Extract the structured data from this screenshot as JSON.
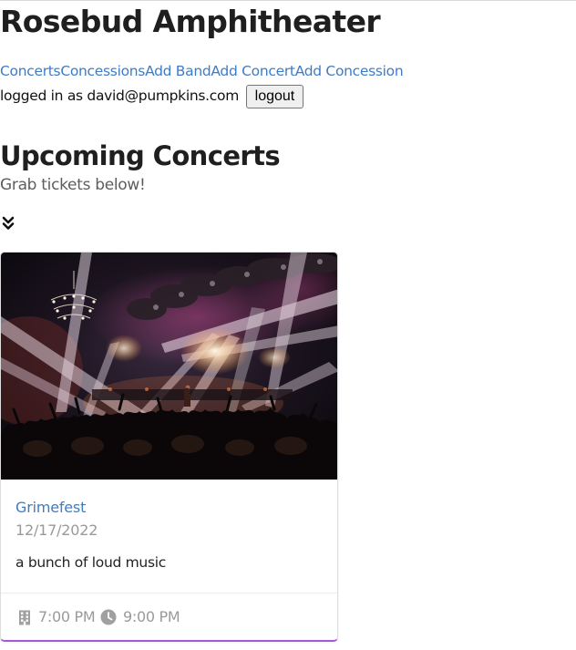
{
  "header": {
    "site_title": "Rosebud Amphitheater"
  },
  "nav": {
    "items": [
      {
        "label": "Concerts"
      },
      {
        "label": "Concessions"
      },
      {
        "label": "Add Band"
      },
      {
        "label": "Add Concert"
      },
      {
        "label": "Add Concession"
      }
    ]
  },
  "session": {
    "logged_in_text": "logged in as david@pumpkins.com",
    "logout_label": "logout"
  },
  "main": {
    "section_title": "Upcoming Concerts",
    "subtitle": "Grab tickets below!",
    "expand_icon": "double-chevron-down-icon"
  },
  "concerts": [
    {
      "band": "Grimefest",
      "date": "12/17/2022",
      "description": "a bunch of loud music",
      "door_time": "7:00 PM",
      "end_time": "9:00 PM",
      "image": "concert-crowd-stage-lights",
      "door_icon": "building-icon",
      "end_icon": "clock-icon"
    }
  ],
  "colors": {
    "link": "#3d7cc9",
    "muted": "#9a9a9a",
    "card_accent": "#a35ad6"
  }
}
